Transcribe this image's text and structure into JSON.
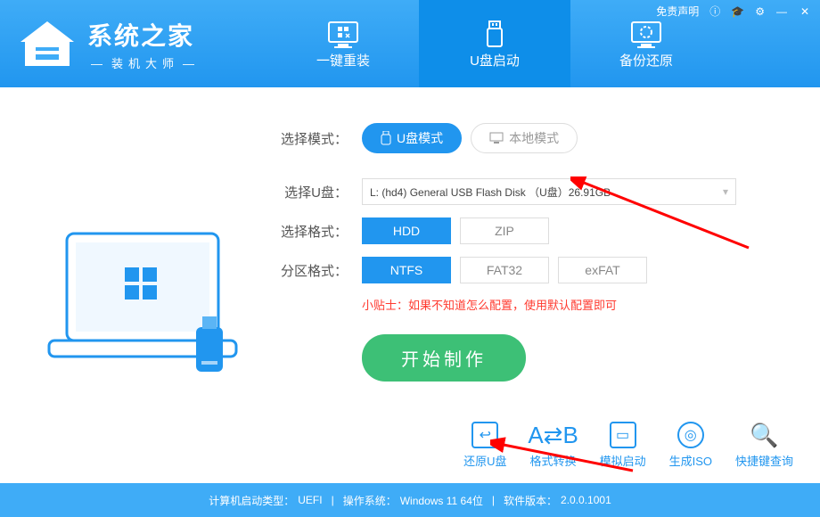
{
  "brand": {
    "title": "系统之家",
    "subtitle": "装机大师"
  },
  "topbar": {
    "disclaimer": "免责声明"
  },
  "tabs": {
    "reinstall": "一键重装",
    "usb": "U盘启动",
    "backup": "备份还原"
  },
  "labels": {
    "mode": "选择模式：",
    "usb": "选择U盘：",
    "format": "选择格式：",
    "partition": "分区格式："
  },
  "mode": {
    "usb": "U盘模式",
    "local": "本地模式"
  },
  "usbSelected": "L: (hd4) General USB Flash Disk （U盘）26.91GB",
  "fmt": {
    "hdd": "HDD",
    "zip": "ZIP"
  },
  "part": {
    "ntfs": "NTFS",
    "fat32": "FAT32",
    "exfat": "exFAT"
  },
  "tip": "小贴士：如果不知道怎么配置，使用默认配置即可",
  "startBtn": "开始制作",
  "tools": {
    "restore": "还原U盘",
    "convert": "格式转换",
    "simulate": "模拟启动",
    "iso": "生成ISO",
    "hotkey": "快捷键查询"
  },
  "footer": {
    "bootTypeLabel": "计算机启动类型：",
    "bootType": "UEFI",
    "osLabel": "操作系统：",
    "os": "Windows 11 64位",
    "verLabel": "软件版本：",
    "ver": "2.0.0.1001"
  }
}
